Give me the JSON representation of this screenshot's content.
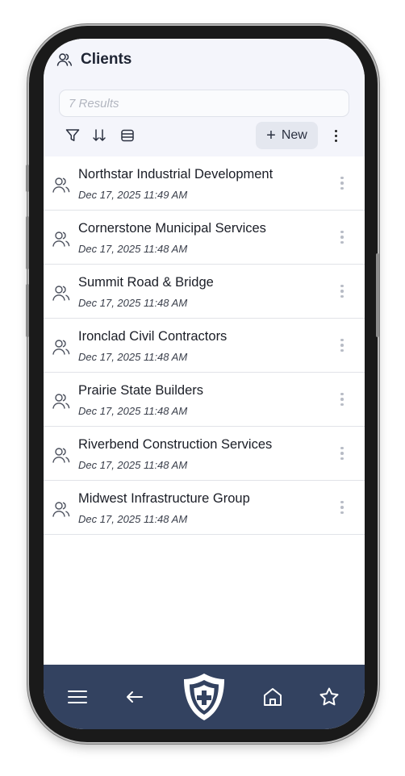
{
  "header": {
    "title": "Clients",
    "icon": "users-icon",
    "search_placeholder": "7 Results",
    "toolbar": {
      "filter_icon": "filter-icon",
      "sort_icon": "sort-icon",
      "view_icon": "view-toggle-icon",
      "new_label": "New",
      "more_icon": "more-vertical-icon"
    }
  },
  "clients": [
    {
      "name": "Northstar Industrial Development",
      "date": "Dec 17, 2025 11:49 AM"
    },
    {
      "name": "Cornerstone Municipal Services",
      "date": "Dec 17, 2025 11:48 AM"
    },
    {
      "name": "Summit Road & Bridge",
      "date": "Dec 17, 2025 11:48 AM"
    },
    {
      "name": "Ironclad Civil Contractors",
      "date": "Dec 17, 2025 11:48 AM"
    },
    {
      "name": "Prairie State Builders",
      "date": "Dec 17, 2025 11:48 AM"
    },
    {
      "name": "Riverbend Construction Services",
      "date": "Dec 17, 2025 11:48 AM"
    },
    {
      "name": "Midwest Infrastructure Group",
      "date": "Dec 17, 2025 11:48 AM"
    }
  ],
  "bottom_nav": {
    "items": [
      "menu-icon",
      "back-arrow-icon",
      "shield-logo-icon",
      "home-icon",
      "star-icon"
    ]
  },
  "colors": {
    "header_bg": "#f4f5fb",
    "bottom_bar": "#334260",
    "text_primary": "#1a1d26"
  }
}
